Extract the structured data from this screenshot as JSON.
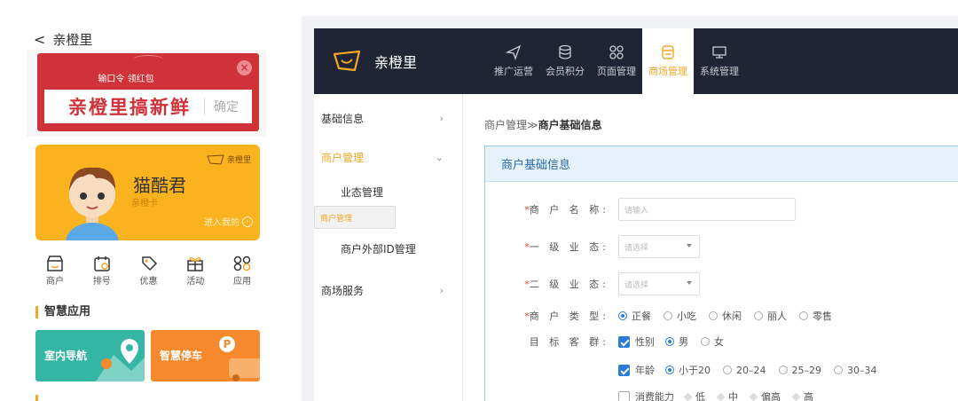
{
  "phone": {
    "title": "亲橙里",
    "back_icon": "chevron-left-icon",
    "promo": {
      "subtitle": "输口令 领红包",
      "code": "亲橙里搞新鲜",
      "confirm": "确定",
      "close_icon": "close-icon"
    },
    "member": {
      "name": "猫酷君",
      "card": "亲橙卡",
      "brand": "亲橙里",
      "enter": "进入我的",
      "enter_icon": "arrow-right-circle-icon"
    },
    "quick_links": [
      {
        "label": "商户",
        "icon": "shop-icon"
      },
      {
        "label": "排号",
        "icon": "queue-icon"
      },
      {
        "label": "优惠",
        "icon": "coupon-icon"
      },
      {
        "label": "活动",
        "icon": "gift-icon"
      },
      {
        "label": "应用",
        "icon": "apps-icon"
      }
    ],
    "section_title": "智慧应用",
    "tiles": [
      {
        "label": "室内导航",
        "color": "#35b6a5"
      },
      {
        "label": "智慧停车",
        "color": "#f6882e"
      }
    ]
  },
  "admin": {
    "brand": "亲橙里",
    "tabs": [
      {
        "label": "推广运营",
        "icon": "send-icon",
        "active": false
      },
      {
        "label": "会员积分",
        "icon": "database-icon",
        "active": false
      },
      {
        "label": "页面管理",
        "icon": "grid-icon",
        "active": false
      },
      {
        "label": "商场管理",
        "icon": "store-icon",
        "active": true
      },
      {
        "label": "系统管理",
        "icon": "monitor-icon",
        "active": false
      }
    ],
    "sidebar": {
      "items": [
        {
          "label": "基础信息",
          "arrow": "›"
        },
        {
          "label": "商户管理",
          "arrow": "⌄"
        },
        {
          "label": "商场服务",
          "arrow": "›"
        }
      ],
      "sub_items": [
        "业态管理",
        "商户管理",
        "商户外部ID管理"
      ]
    },
    "breadcrumb": {
      "parent": "商户管理≫",
      "current": "商户基础信息"
    },
    "panel_title": "商户基础信息",
    "form": {
      "name_label": "商 户 名 称:",
      "name_placeholder": "请输入",
      "level1_label": "一 级 业 态:",
      "level1_placeholder": "请选择",
      "level2_label": "二 级 业 态:",
      "level2_placeholder": "请选择",
      "type_label": "商 户 类 型:",
      "type_options": [
        "正餐",
        "小吃",
        "休闲",
        "丽人",
        "零售"
      ],
      "type_selected": "正餐",
      "target_label": "目 标 客 群:",
      "gender_label": "性别",
      "gender_options": [
        "男",
        "女"
      ],
      "age_label": "年龄",
      "age_options": [
        "小于20",
        "20–24",
        "25–29",
        "30–34"
      ],
      "spend_label": "消费能力",
      "spend_options": [
        "低",
        "中",
        "偏高",
        "高"
      ],
      "required_mark": "*"
    },
    "colors": {
      "accent": "#f5a623",
      "primary": "#2b7bd8",
      "topbar": "#1f2534"
    }
  }
}
